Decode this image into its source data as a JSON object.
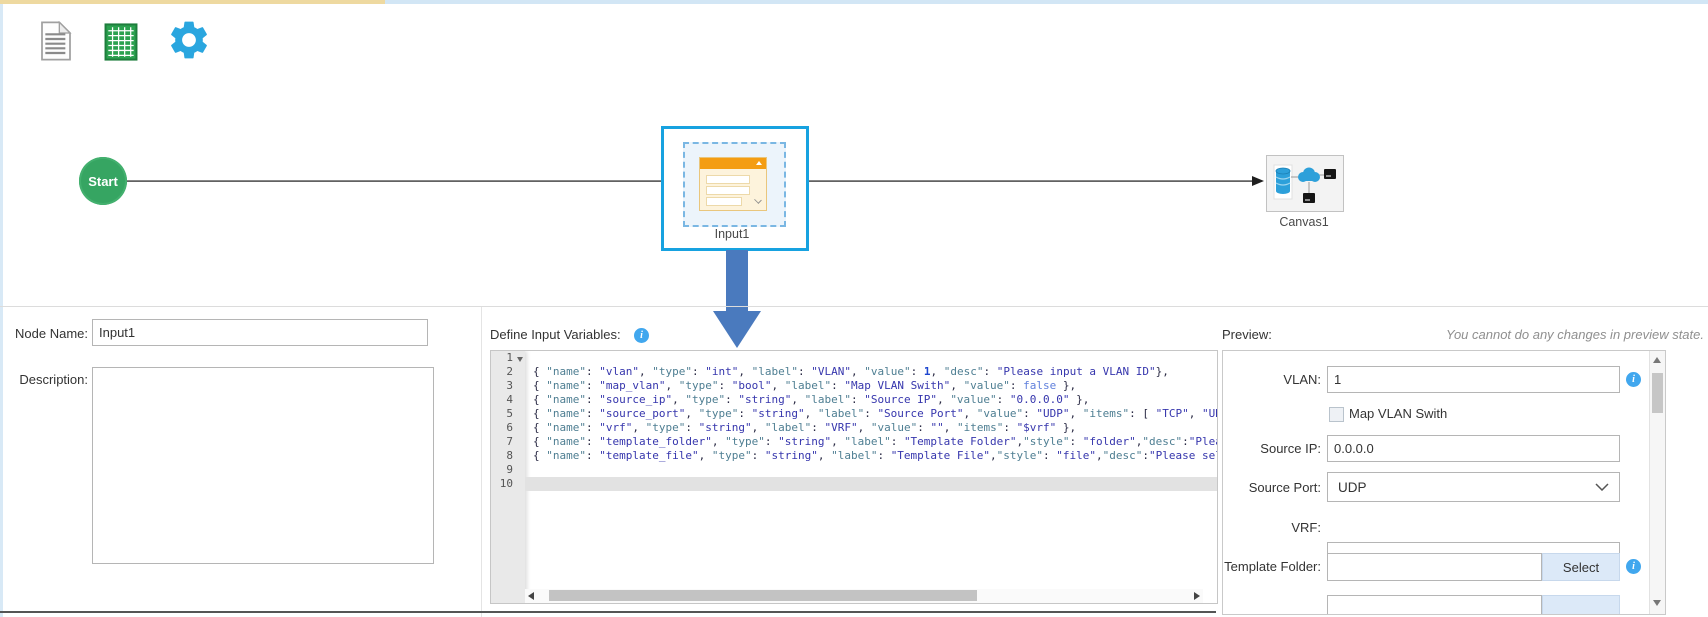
{
  "toolbar": {
    "icons": [
      "document-icon",
      "spreadsheet-icon",
      "settings-gear-icon"
    ]
  },
  "canvas": {
    "start_label": "Start",
    "input_label": "Input1",
    "canvas_label": "Canvas1"
  },
  "left_panel": {
    "node_name_label": "Node Name:",
    "node_name_value": "Input1",
    "description_label": "Description:",
    "description_value": ""
  },
  "editor_panel": {
    "title": "Define Input Variables:",
    "active_line": 10,
    "lines": [
      {
        "n": 1,
        "fold": true,
        "text": ""
      },
      {
        "n": 2,
        "fold": false,
        "text": "{ \"name\": \"vlan\", \"type\": \"int\", \"label\": \"VLAN\", \"value\": 1, \"desc\": \"Please input a VLAN ID\"},"
      },
      {
        "n": 3,
        "fold": false,
        "text": "{ \"name\": \"map_vlan\", \"type\": \"bool\", \"label\": \"Map VLAN Swith\", \"value\": false },"
      },
      {
        "n": 4,
        "fold": false,
        "text": "{ \"name\": \"source_ip\", \"type\": \"string\", \"label\": \"Source IP\", \"value\": \"0.0.0.0\" },"
      },
      {
        "n": 5,
        "fold": false,
        "text": "{ \"name\": \"source_port\", \"type\": \"string\", \"label\": \"Source Port\", \"value\": \"UDP\", \"items\": [ \"TCP\", \"UDP"
      },
      {
        "n": 6,
        "fold": false,
        "text": "{ \"name\": \"vrf\", \"type\": \"string\", \"label\": \"VRF\", \"value\": \"\", \"items\": \"$vrf\" },"
      },
      {
        "n": 7,
        "fold": false,
        "text": "{ \"name\": \"template_folder\", \"type\": \"string\", \"label\": \"Template Folder\",\"style\": \"folder\",\"desc\":\"Pleas"
      },
      {
        "n": 8,
        "fold": false,
        "text": "{ \"name\": \"template_file\", \"type\": \"string\", \"label\": \"Template File\",\"style\": \"file\",\"desc\":\"Please sele"
      },
      {
        "n": 9,
        "fold": false,
        "text": ""
      },
      {
        "n": 10,
        "fold": false,
        "text": ""
      }
    ]
  },
  "preview_panel": {
    "title": "Preview:",
    "notice": "You cannot do any changes in preview state.",
    "fields": {
      "vlan_label": "VLAN:",
      "vlan_value": "1",
      "map_vlan_label": "Map VLAN Swith",
      "map_vlan_checked": false,
      "source_ip_label": "Source IP:",
      "source_ip_value": "0.0.0.0",
      "source_port_label": "Source Port:",
      "source_port_value": "UDP",
      "vrf_label": "VRF:",
      "vrf_value": "",
      "template_folder_label": "Template Folder:",
      "template_folder_value": "",
      "select_button_label": "Select"
    }
  },
  "colors": {
    "accent_blue": "#2aa6df",
    "selection_blue": "#17a2e0",
    "arrow_blue": "#4a7abe",
    "start_green": "#36a562",
    "info_blue": "#41a7ee",
    "sheet_green": "#2ba14f",
    "form_orange": "#f49d13"
  }
}
